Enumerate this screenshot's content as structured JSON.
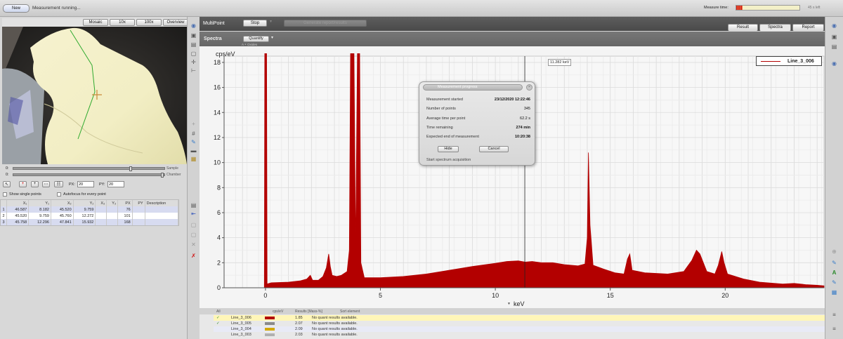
{
  "topbar": {
    "new_label": "New",
    "status": "Measurement running...",
    "measure_time_label": "Measure time:",
    "measure_time_value": "45 s left",
    "measure_progress_fraction": 0.1
  },
  "left": {
    "view_tabs": [
      "Mosaic",
      "10x",
      "100x",
      "Overview"
    ],
    "slider_labels": [
      "Sample",
      "Chamber"
    ],
    "slider_prefix": [
      "0:",
      "0:"
    ],
    "px_label": "PX:",
    "px_value": "20",
    "py_label": "PY:",
    "py_value": "20",
    "show_single_points": "Show single points",
    "autofocus": "Autofocus for every point",
    "table": {
      "columns": [
        "",
        "X₁",
        "Y₁",
        "X₂",
        "Y₂",
        "X₃",
        "Y₃",
        "PX",
        "PY",
        "Description"
      ],
      "rows": [
        [
          "1",
          "46.587",
          "8.182",
          "45.520",
          "9.759",
          "",
          "",
          "76",
          "",
          ""
        ],
        [
          "2",
          "45.520",
          "9.759",
          "45.760",
          "12.272",
          "",
          "",
          "101",
          "",
          ""
        ],
        [
          "3",
          "45.758",
          "12.296",
          "47.841",
          "15.932",
          "",
          "",
          "168",
          "",
          ""
        ]
      ]
    }
  },
  "main": {
    "title": "MultiPoint",
    "stop_label": "Stop",
    "generate_label": "Generate report/results",
    "tabs": [
      "Result",
      "Spectra",
      "Report"
    ],
    "spectra_label": "Spectra",
    "quantify_label": "Quantify",
    "oxides_label": "A  ∘  Oxides",
    "cursor_readout": "11.282 keV"
  },
  "dialog": {
    "title": "Measurement progress",
    "rows": [
      {
        "label": "Measurement started",
        "value": "23/12/2020 12:22:46"
      },
      {
        "label": "Number of points",
        "value": "345"
      },
      {
        "label": "Average time per point",
        "value": "62.2 s"
      },
      {
        "label": "Time remaining",
        "value": "274 min"
      },
      {
        "label": "Expected end of measurement",
        "value": "10:20:38"
      }
    ],
    "hide_label": "Hide",
    "cancel_label": "Cancel",
    "status": "Start spectrum acquisition"
  },
  "chart_data": {
    "type": "area",
    "ylabel": "cps/eV",
    "xlabel": "keV",
    "xlim": [
      -1.8,
      24.3
    ],
    "ylim": [
      0,
      18.5
    ],
    "x_ticks": [
      0,
      5,
      10,
      15,
      20
    ],
    "y_ticks": [
      0,
      2,
      4,
      6,
      8,
      10,
      12,
      14,
      16,
      18
    ],
    "cursor_x": 11.282,
    "legend": "Line_3_006",
    "series_color": "#b30000",
    "series": [
      {
        "name": "Line_3_006",
        "points": [
          [
            -0.05,
            0
          ],
          [
            -0.03,
            19
          ],
          [
            0.05,
            19
          ],
          [
            0.07,
            0.3
          ],
          [
            0.25,
            0.4
          ],
          [
            1.0,
            0.45
          ],
          [
            1.5,
            0.55
          ],
          [
            1.8,
            0.7
          ],
          [
            1.95,
            1.0
          ],
          [
            2.05,
            0.6
          ],
          [
            2.3,
            0.6
          ],
          [
            2.5,
            0.9
          ],
          [
            2.65,
            1.6
          ],
          [
            2.75,
            2.7
          ],
          [
            2.82,
            1.7
          ],
          [
            2.9,
            1.0
          ],
          [
            3.1,
            0.9
          ],
          [
            3.3,
            1.0
          ],
          [
            3.55,
            1.3
          ],
          [
            3.65,
            3.0
          ],
          [
            3.7,
            19
          ],
          [
            3.85,
            19
          ],
          [
            3.92,
            3.0
          ],
          [
            4.0,
            19
          ],
          [
            4.1,
            19
          ],
          [
            4.15,
            2.0
          ],
          [
            4.3,
            0.8
          ],
          [
            5.0,
            0.8
          ],
          [
            6.0,
            0.9
          ],
          [
            7.0,
            1.1
          ],
          [
            8.0,
            1.4
          ],
          [
            9.0,
            1.7
          ],
          [
            10.0,
            1.95
          ],
          [
            10.5,
            2.1
          ],
          [
            11.0,
            2.15
          ],
          [
            11.3,
            2.05
          ],
          [
            11.6,
            2.1
          ],
          [
            12.0,
            2.0
          ],
          [
            12.5,
            2.0
          ],
          [
            13.0,
            1.85
          ],
          [
            13.6,
            1.75
          ],
          [
            13.9,
            1.9
          ],
          [
            14.0,
            4.0
          ],
          [
            14.05,
            10.8
          ],
          [
            14.12,
            5.0
          ],
          [
            14.25,
            1.8
          ],
          [
            14.7,
            1.5
          ],
          [
            15.2,
            1.2
          ],
          [
            15.6,
            1.1
          ],
          [
            15.75,
            2.3
          ],
          [
            15.85,
            2.7
          ],
          [
            15.95,
            1.4
          ],
          [
            16.5,
            1.2
          ],
          [
            17.5,
            1.1
          ],
          [
            18.2,
            1.3
          ],
          [
            18.55,
            2.2
          ],
          [
            18.75,
            3.0
          ],
          [
            18.9,
            2.7
          ],
          [
            19.2,
            1.3
          ],
          [
            19.55,
            1.1
          ],
          [
            19.7,
            1.8
          ],
          [
            19.85,
            2.9
          ],
          [
            19.95,
            2.0
          ],
          [
            20.1,
            1.1
          ],
          [
            20.8,
            0.7
          ],
          [
            21.5,
            0.45
          ],
          [
            22.5,
            0.3
          ],
          [
            23.0,
            0.35
          ],
          [
            23.5,
            0.25
          ],
          [
            24.0,
            0.2
          ],
          [
            24.3,
            0.15
          ]
        ]
      }
    ]
  },
  "bottom": {
    "header": {
      "all": "All",
      "cps": "cps/eV",
      "results": "Results [Mass-%]",
      "sort": "Sort element"
    },
    "rows": [
      {
        "name": "Line_3_006",
        "color": "#b30000",
        "cps": "1.85",
        "result": "No quant results available.",
        "checked": "✓"
      },
      {
        "name": "Line_3_005",
        "color": "#8a8a8a",
        "cps": "2.07",
        "result": "No quant results available.",
        "checked": "✓"
      },
      {
        "name": "Line_3_004",
        "color": "#d4a800",
        "cps": "2.09",
        "result": "No quant results available.",
        "checked": ""
      },
      {
        "name": "Line_3_003",
        "color": "#b0b0b0",
        "cps": "2.03",
        "result": "No quant results available.",
        "checked": ""
      }
    ]
  }
}
